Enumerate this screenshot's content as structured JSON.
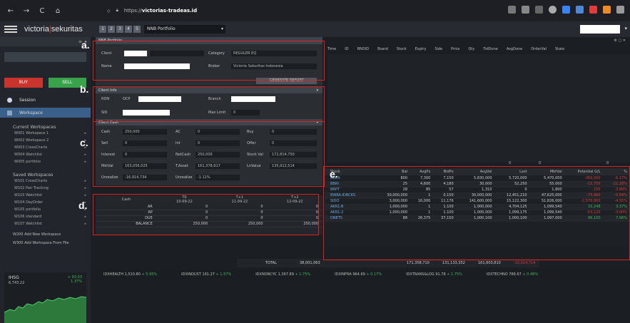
{
  "browser": {
    "url_prefix": "https://",
    "url_host": "victorias-tradeas.id",
    "nav": [
      "←",
      "→",
      "C",
      "⌂"
    ]
  },
  "app": {
    "logo_left": "victoria",
    "logo_right": "sekuritas",
    "workspace_tabs": [
      "1",
      "2",
      "3",
      "4",
      "5"
    ],
    "workspace_select": "NNB Portfolio"
  },
  "sidebar": {
    "buy_label": "BUY",
    "sell_label": "SELL",
    "session_label": "Session",
    "workspace_label": "Workspace",
    "current_heading": "Current Workspaces",
    "current_items": [
      "W001  Workspace 1",
      "W002  Workspace 2",
      "W003  CrossCharts",
      "W004  Watchlist",
      "W005  portfolio"
    ],
    "saved_heading": "Saved Workspaces",
    "saved_items": [
      "W101  CrossCharts",
      "W102  Pair Tracking",
      "W103  Watchlist",
      "W104  DayOrder",
      "W105  portfolio",
      "W106  standard",
      "W107  Watchlist"
    ],
    "add_ws": "W200  Add New Workspace",
    "add_ws_file": "W300  Add Workspace From File",
    "index_name": "IHSG",
    "index_value": "6,743.22",
    "index_change": "+ 93.03",
    "index_pct": "1.37%"
  },
  "section_a": {
    "title": "NNB Portfolio",
    "client_label": "Client",
    "category_label": "Category",
    "category_value": "REGULER EQ",
    "name_label": "Name",
    "broker_label": "Broker",
    "broker_value": "Victoria Sekuritas Indonesia",
    "report_button": "GENERATE REPORT"
  },
  "section_b": {
    "title": "Client Info",
    "sid_label": "SID",
    "rdn_label": "RDN",
    "rdn_bank": "OCP",
    "branch_label": "Branch",
    "maxlimit_label": "Max Limit",
    "maxlimit_value": "0"
  },
  "section_c": {
    "title": "Client Cash",
    "rows": [
      [
        "Cash",
        "250,000",
        "AC",
        "0",
        "Buy",
        "0"
      ],
      [
        "Sell",
        "0",
        "Int",
        "0",
        "Offer",
        "0"
      ],
      [
        "Interest",
        "0",
        "NetCash",
        "250,000",
        "Stock Val",
        "172,814,750"
      ],
      [
        "MktVal",
        "163,056,025",
        "T.Asset",
        "161,378,917",
        "LnValue",
        "135,912,514"
      ],
      [
        "Unrealize",
        "-16,914,734",
        "Unrealize",
        "-1.11%",
        "",
        ""
      ]
    ]
  },
  "section_d": {
    "headers": [
      "Cash",
      "T0",
      "T+1",
      "T+2"
    ],
    "sub_headers": [
      "",
      "10-09-22",
      "11-09-22",
      "12-09-22"
    ],
    "rows": [
      [
        "AR",
        "0",
        "0",
        "0"
      ],
      [
        "AP",
        "0",
        "0",
        "0"
      ],
      [
        "DUE",
        "0",
        "0",
        "0"
      ],
      [
        "BALANCE",
        "250,000",
        "250,000",
        "250,000"
      ]
    ]
  },
  "orders": {
    "headers": [
      "Time",
      "ID",
      "RNOID",
      "Board",
      "Stock",
      "Expiry",
      "Side",
      "Price",
      "Qty",
      "TrdDone",
      "AvgDone",
      "OrderVal",
      "State"
    ]
  },
  "section_e": {
    "sub_values": [
      "0",
      "0",
      "0"
    ],
    "headers": [
      "Stock",
      "Bal",
      "AvgPx",
      "BidPx",
      "AvgVal",
      "Last",
      "MktVal",
      "Potential G/L",
      "%"
    ],
    "rows": [
      [
        "BBCA",
        "800",
        "7,300",
        "7,150",
        "5,830,000",
        "5,720,000",
        "5,470,000",
        "-360,000",
        "-6.17%"
      ],
      [
        "BBRI",
        "25",
        "4,600",
        "4,180",
        "30,000",
        "52,250",
        "55,000",
        "-15,750",
        "-21.28%"
      ],
      [
        "BRPT",
        "28",
        "85",
        "57",
        "1,310",
        "0",
        "1,800",
        "-150",
        "-3.89%"
      ],
      [
        "BWRA-IDBCKS",
        "30,000,000",
        "1",
        "0.150",
        "30,000,000",
        "12,451,210",
        "47,625,000",
        "-75,960",
        "-0.84%"
      ],
      [
        "SIDO",
        "3,000,000",
        "16,000",
        "11,176",
        "141,600,000",
        "15,122,300",
        "51,826,000",
        "-2,578,800",
        "-4.55%"
      ],
      [
        "AKR1-B",
        "1,000,000",
        "1",
        "1.100",
        "1,000,000",
        "4,704,125",
        "1,099,540",
        "33,248",
        "3.37%"
      ],
      [
        "AKR1-2",
        "1,000,000",
        "1",
        "1.100",
        "1,000,000",
        "1,099,175",
        "1,099,540",
        "-53,120",
        "-3.00%"
      ],
      [
        "DNETS",
        "88",
        "26,375",
        "37,150",
        "1,000,100",
        "1,000,100",
        "1,097,000",
        "96,100",
        "7.96%"
      ]
    ],
    "totals_label": "TOTAL",
    "totals": [
      "38,001,063",
      "171,358,710",
      "131,133,352",
      "161,603,810",
      "-15,014,714"
    ]
  },
  "ticker": [
    {
      "name": "IDXHEALTH",
      "value": "1,510.80",
      "chg": "+ 5.95%",
      "dir": "up"
    },
    {
      "name": "IDXINDUST",
      "value": "191.27",
      "chg": "+ 1.57%",
      "dir": "up"
    },
    {
      "name": "IDXNONCYC",
      "value": "1,367.89",
      "chg": "+ 1.75%",
      "dir": "up"
    },
    {
      "name": "IDXINFRA",
      "value": "964.69",
      "chg": "+ 0.17%",
      "dir": "up"
    },
    {
      "name": "IDXTRANS&LOG",
      "value": "91.78",
      "chg": "+ 1.75%",
      "dir": "up"
    },
    {
      "name": "IDXTECHNO",
      "value": "789.67",
      "chg": "+ 0.48%",
      "dir": "up"
    }
  ],
  "annotations": [
    "a.",
    "b.",
    "c.",
    "d.",
    "e."
  ],
  "colors": {
    "annotation_red": "#e02020",
    "buy": "#c9342d",
    "sell": "#38a34b",
    "accent_blue": "#3a5f88"
  }
}
